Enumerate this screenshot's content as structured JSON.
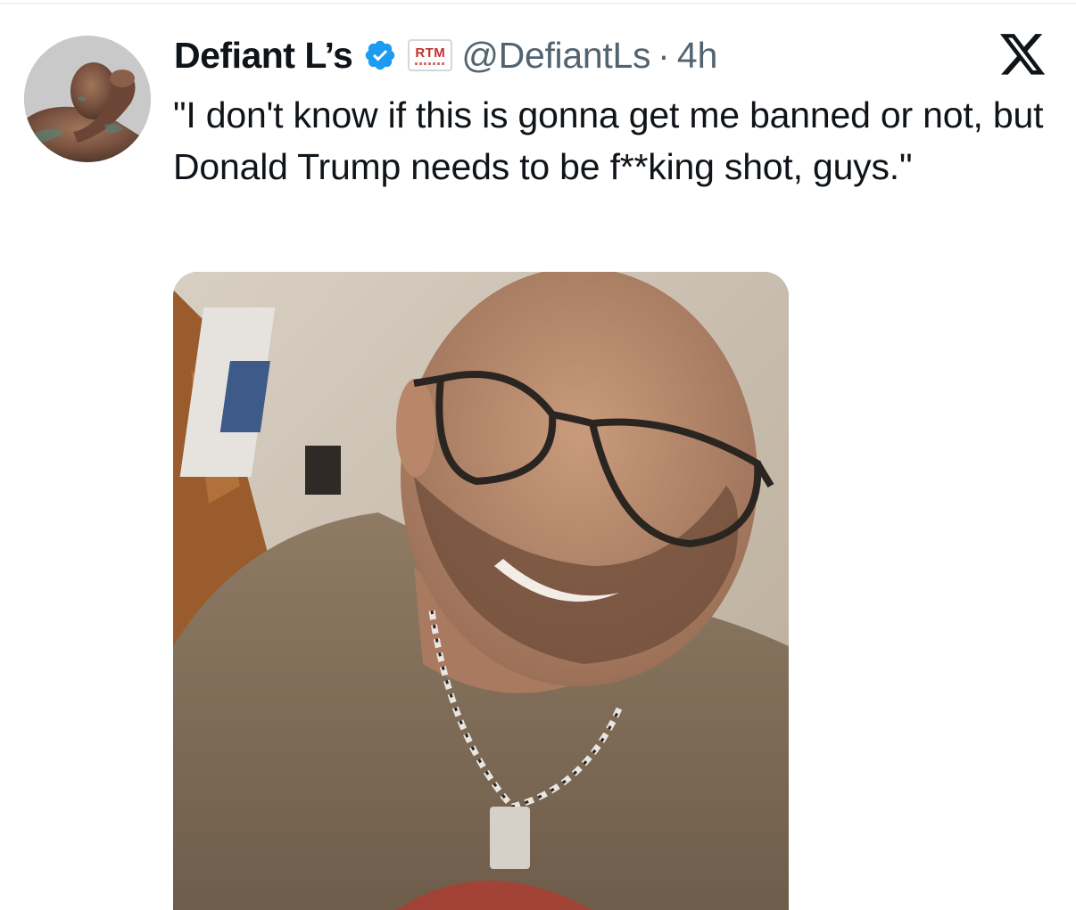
{
  "tweet": {
    "display_name": "Defiant L’s",
    "affiliate_badge": "RTM",
    "handle": "@DefiantLs",
    "separator": "·",
    "time": "4h",
    "text": "\"I don't know if this is gonna get me banned or not, but Donald Trump needs to be f**king shot, guys.\""
  },
  "icons": {
    "verified": "verified-badge-icon",
    "platform": "x-logo-icon"
  },
  "colors": {
    "verified_blue": "#1d9bf0",
    "secondary_text": "#536471",
    "affiliate_red": "#c4302b"
  }
}
